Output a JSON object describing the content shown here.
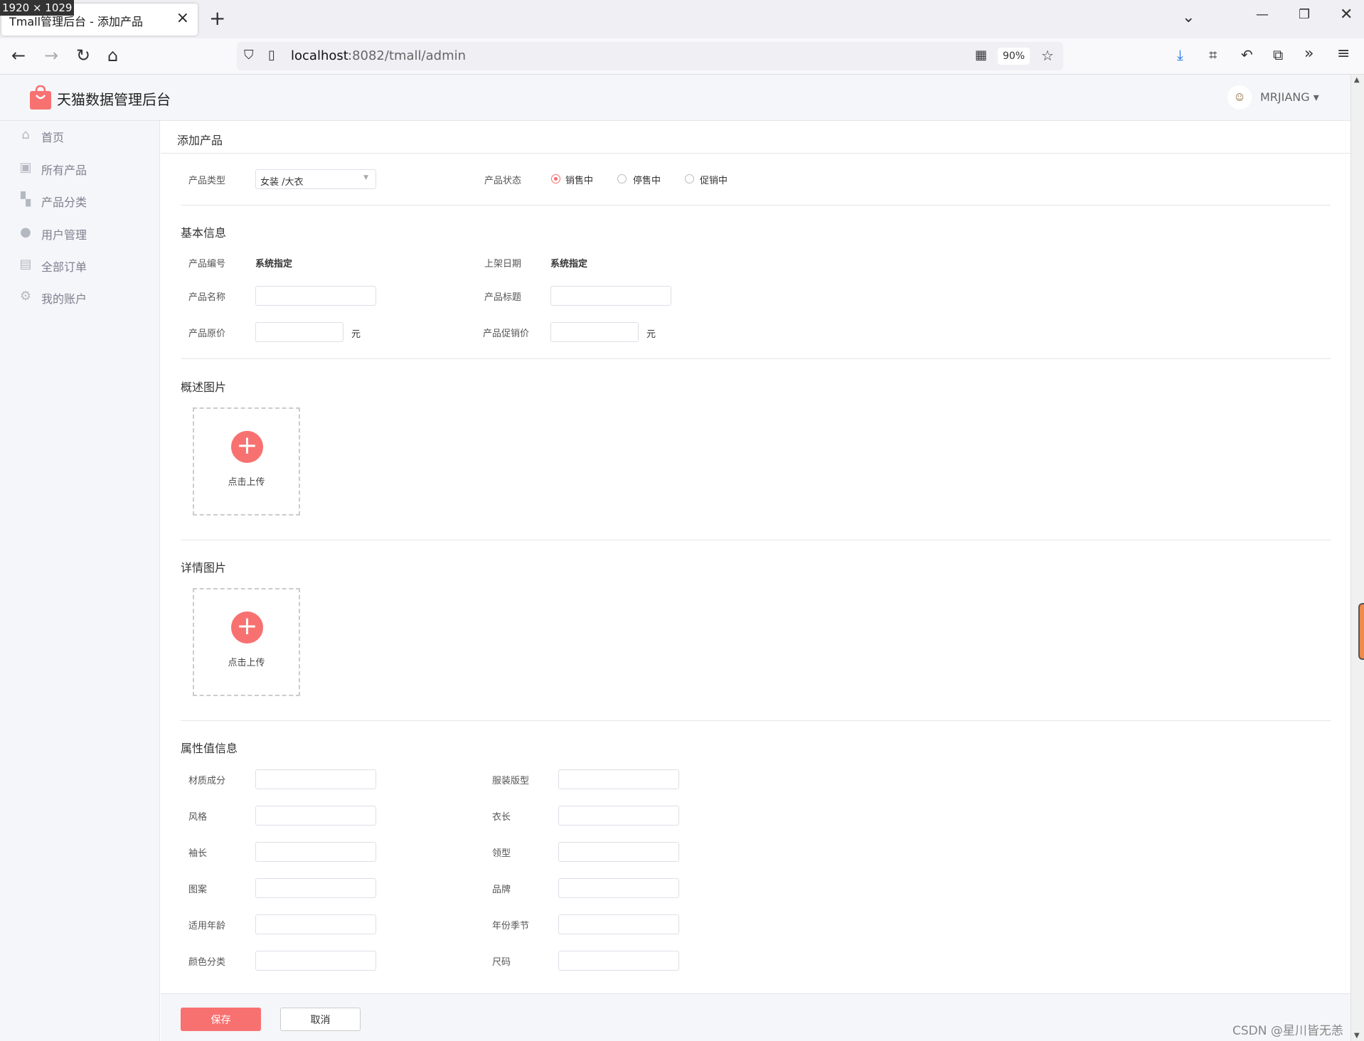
{
  "overlay": {
    "dimensions": "1920 × 1029"
  },
  "browser": {
    "tab_title": "Tmall管理后台 - 添加产品",
    "url_host": "localhost",
    "url_rest": ":8082/tmall/admin",
    "zoom": "90%"
  },
  "header": {
    "brand": "天猫数据管理后台",
    "user": "MRJIANG"
  },
  "sidebar": {
    "items": [
      {
        "label": "首页",
        "icon": "home-icon"
      },
      {
        "label": "所有产品",
        "icon": "product-icon"
      },
      {
        "label": "产品分类",
        "icon": "category-icon"
      },
      {
        "label": "用户管理",
        "icon": "user-icon"
      },
      {
        "label": "全部订单",
        "icon": "order-icon"
      },
      {
        "label": "我的账户",
        "icon": "gear-icon"
      }
    ]
  },
  "main": {
    "breadcrumb": "添加产品",
    "type_label": "产品类型",
    "type_value": "女装 /大衣",
    "status_label": "产品状态",
    "status_options": [
      "销售中",
      "停售中",
      "促销中"
    ],
    "basic": {
      "title": "基本信息",
      "code_label": "产品编号",
      "code_value": "系统指定",
      "date_label": "上架日期",
      "date_value": "系统指定",
      "name_label": "产品名称",
      "headline_label": "产品标题",
      "price_label": "产品原价",
      "sale_label": "产品促销价",
      "unit": "元"
    },
    "overview": {
      "title": "概述图片",
      "upload": "点击上传"
    },
    "detail": {
      "title": "详情图片",
      "upload": "点击上传"
    },
    "attrs": {
      "title": "属性值信息",
      "left": [
        "材质成分",
        "风格",
        "袖长",
        "图案",
        "适用年龄",
        "颜色分类"
      ],
      "right": [
        "服装版型",
        "衣长",
        "领型",
        "品牌",
        "年份季节",
        "尺码"
      ]
    },
    "buttons": {
      "save": "保存",
      "cancel": "取消"
    }
  },
  "watermark": "CSDN @星川皆无恙",
  "colors": {
    "accent": "#f87171",
    "radio_checked": "#f56c6c"
  }
}
